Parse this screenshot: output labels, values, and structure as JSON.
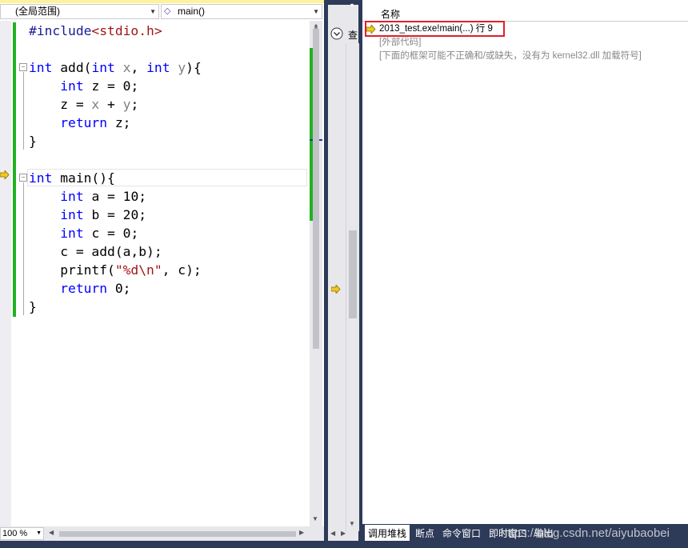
{
  "editor": {
    "scope_dropdown": "(全局范围)",
    "function_dropdown": "main()",
    "zoom": "100 %",
    "code_lines": [
      "#include<stdio.h>",
      "",
      "int add(int x, int y){",
      "    int z = 0;",
      "    z = x + y;",
      "    return z;",
      "}",
      "",
      "int main(){",
      "    int a = 10;",
      "    int b = 20;",
      "    int c = 0;",
      "    c = add(a,b);",
      "    printf(\"%d\\n\", c);",
      "    return 0;",
      "}"
    ],
    "current_line_index": 8
  },
  "middle_pane": {
    "label": "查"
  },
  "call_stack": {
    "column_header": "名称",
    "rows": [
      "2013_test.exe!main(...) 行 9",
      "[外部代码]",
      "[下面的框架可能不正确和/或缺失，没有为 kernel32.dll 加载符号]"
    ]
  },
  "bottom_tabs": [
    "调用堆栈",
    "断点",
    "命令窗口",
    "即时窗口",
    "输出"
  ],
  "watermark": "https://blog.csdn.net/aiyubaobei",
  "colors": {
    "highlight_box": "#e0202a",
    "green_change_bar": "#22b122",
    "keyword": "#0000ff",
    "string": "#a31515",
    "current_arrow": "#f2c81c"
  }
}
